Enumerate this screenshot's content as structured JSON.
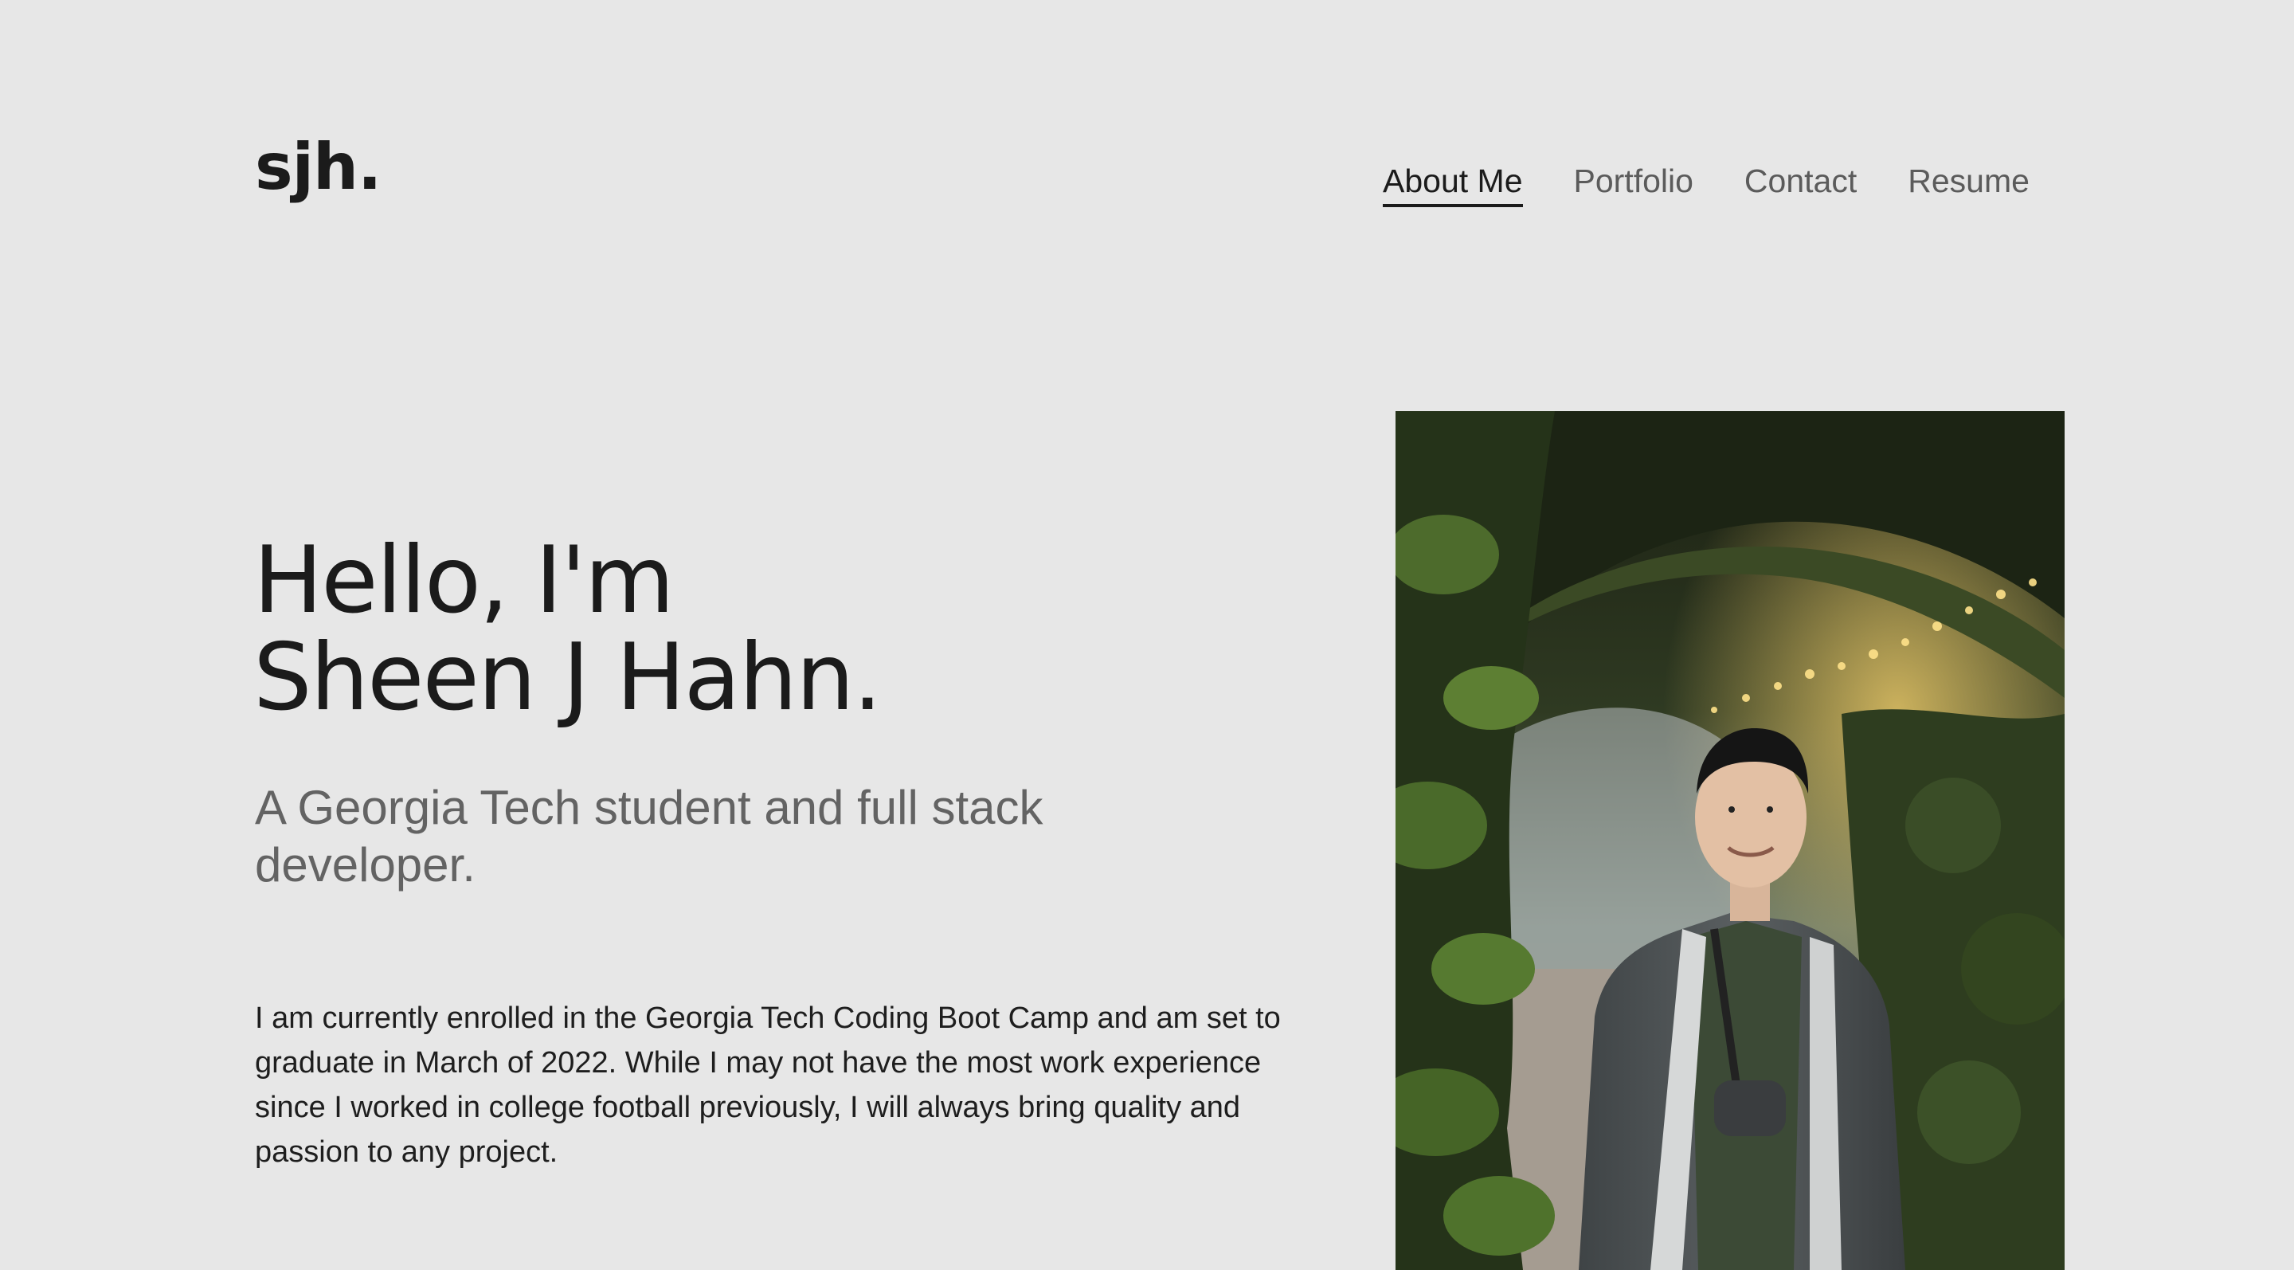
{
  "header": {
    "logo": "sjh.",
    "nav": [
      {
        "label": "About Me",
        "active": true
      },
      {
        "label": "Portfolio",
        "active": false
      },
      {
        "label": "Contact",
        "active": false
      },
      {
        "label": "Resume",
        "active": false
      }
    ]
  },
  "hero": {
    "title_line1": "Hello, I'm",
    "title_line2": "Sheen J Hahn.",
    "subtitle": "A Georgia Tech student and full stack developer.",
    "bio": "I am currently enrolled in the Georgia Tech Coding Boot Camp and am set to graduate in March of 2022. While I may not have the most work experience since I worked in college football previously, I will always bring quality and passion to any project."
  },
  "photo": {
    "icon": "portrait-photo"
  },
  "colors": {
    "background": "#e7e7e7",
    "text": "#1b1b1b",
    "muted": "#636363"
  }
}
